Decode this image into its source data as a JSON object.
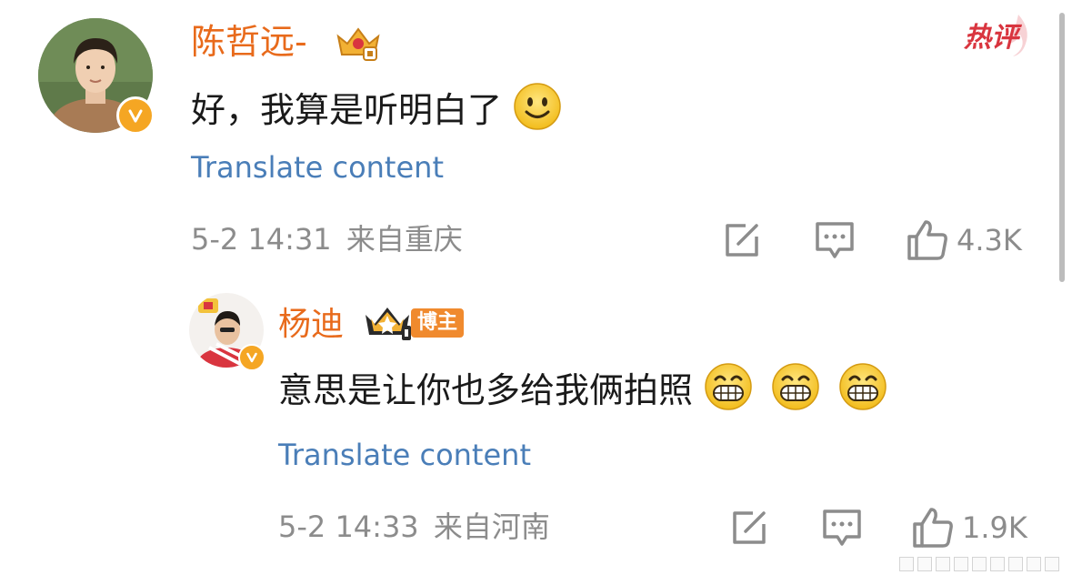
{
  "colors": {
    "username": "#e86a1b",
    "link": "#4a7eb8",
    "meta": "#8c8c8c",
    "text": "#1a1a1a",
    "vip_badge": "#f5a623",
    "hot": "#d9353f"
  },
  "comments": [
    {
      "username": "陈哲远-",
      "text": "好，我算是听明白了",
      "emoji": [
        "smile-emoji"
      ],
      "translate": "Translate content",
      "time": "5-2 14:31",
      "location": "来自重庆",
      "likes": "4.3K",
      "hot_label": "热评",
      "badge_icon": "crown-level-icon"
    },
    {
      "username": "杨迪",
      "blogger_badge": "博主",
      "text": "意思是让你也多给我俩拍照",
      "emoji": [
        "grin-emoji",
        "grin-emoji",
        "grin-emoji"
      ],
      "translate": "Translate content",
      "time": "5-2 14:33",
      "location": "来自河南",
      "likes": "1.9K",
      "badge_icon": "crown-icon"
    }
  ]
}
